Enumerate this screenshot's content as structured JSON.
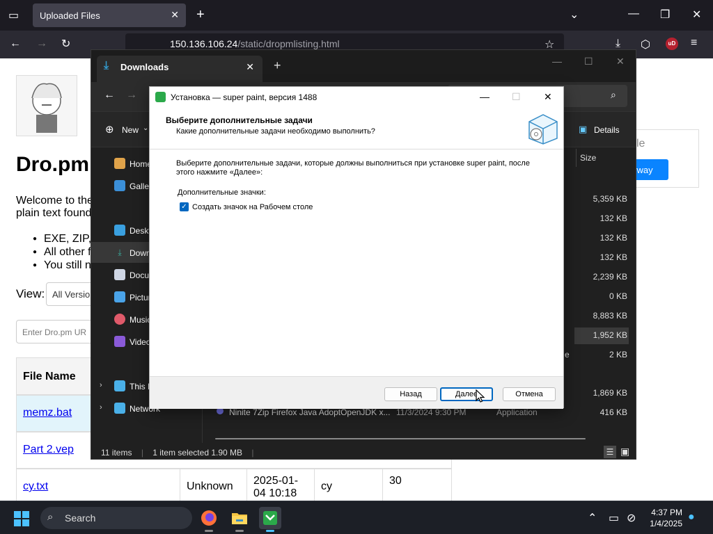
{
  "browser": {
    "tab_title": "Uploaded Files",
    "tab_close": "✕",
    "new_tab": "+",
    "url_host": "150.136.106.24",
    "url_path": "/static/dropmlisting.html",
    "ext_badge": "uD"
  },
  "page": {
    "site_title": "Dro.pm",
    "intro_line1": "Welcome to the",
    "intro_line2": "plain text found",
    "bullets": [
      "EXE, ZIP,",
      "All other f",
      "You still n"
    ],
    "view_label": "View:",
    "view_value": "All Version",
    "url_placeholder": "Enter Dro.pm UR",
    "table_header": "File Name",
    "rows": [
      {
        "name": "memz.bat"
      },
      {
        "name": "Part 2.vep"
      },
      {
        "name": "cy.txt",
        "type": "Unknown",
        "date_line1": "2025-01-",
        "date_line2": "04 10:18",
        "owner": "cy",
        "count": "30"
      }
    ],
    "promo_text": "le",
    "promo_button": "yway"
  },
  "explorer": {
    "tab_title": "Downloads",
    "cmd_new": "New",
    "cmd_details": "Details",
    "col_size": "Size",
    "sidebar": [
      {
        "label": "Home",
        "icon": "home-icon"
      },
      {
        "label": "Galler",
        "icon": "gallery-icon"
      },
      {
        "label": "Deskt",
        "icon": "desktop-icon"
      },
      {
        "label": "Down",
        "icon": "downloads-icon"
      },
      {
        "label": "Docu",
        "icon": "documents-icon"
      },
      {
        "label": "Pictur",
        "icon": "pictures-icon"
      },
      {
        "label": "Music",
        "icon": "music-icon"
      },
      {
        "label": "Video",
        "icon": "videos-icon"
      },
      {
        "label": "This P",
        "icon": "this-pc-icon"
      },
      {
        "label": "Network",
        "icon": "network-icon"
      }
    ],
    "sizes": [
      "5,359 KB",
      "132 KB",
      "132 KB",
      "132 KB",
      "2,239 KB",
      "0 KB",
      "8,883 KB",
      "1,952 KB",
      "2 KB",
      "1,869 KB",
      "416 KB"
    ],
    "partial_type": "e",
    "last_file_name": "Ninite 7Zip Firefox Java AdoptOpenJDK x...",
    "last_file_date": "11/3/2024 9:30 PM",
    "last_file_type": "Application",
    "status_items": "11 items",
    "status_selected": "1 item selected  1.90 MB"
  },
  "installer": {
    "title": "Установка — super paint, версия 1488",
    "heading": "Выберите дополнительные задачи",
    "subheading": "Какие дополнительные задачи необходимо выполнить?",
    "description": "Выберите дополнительные задачи, которые должны выполниться при установке super paint, после этого нажмите «Далее»:",
    "group_label": "Дополнительные значки:",
    "checkbox_label": "Создать значок на Рабочем столе",
    "checkbox_checked": true,
    "btn_back": "Назад",
    "btn_next": "Далее",
    "btn_cancel": "Отмена"
  },
  "taskbar": {
    "search": "Search",
    "time": "4:37 PM",
    "date": "1/4/2025"
  },
  "colors": {
    "accent": "#0067c0",
    "link": "#0000ee",
    "row_highlight": "#e2f4fb",
    "taskbar_accent": "#4cc2ff"
  }
}
